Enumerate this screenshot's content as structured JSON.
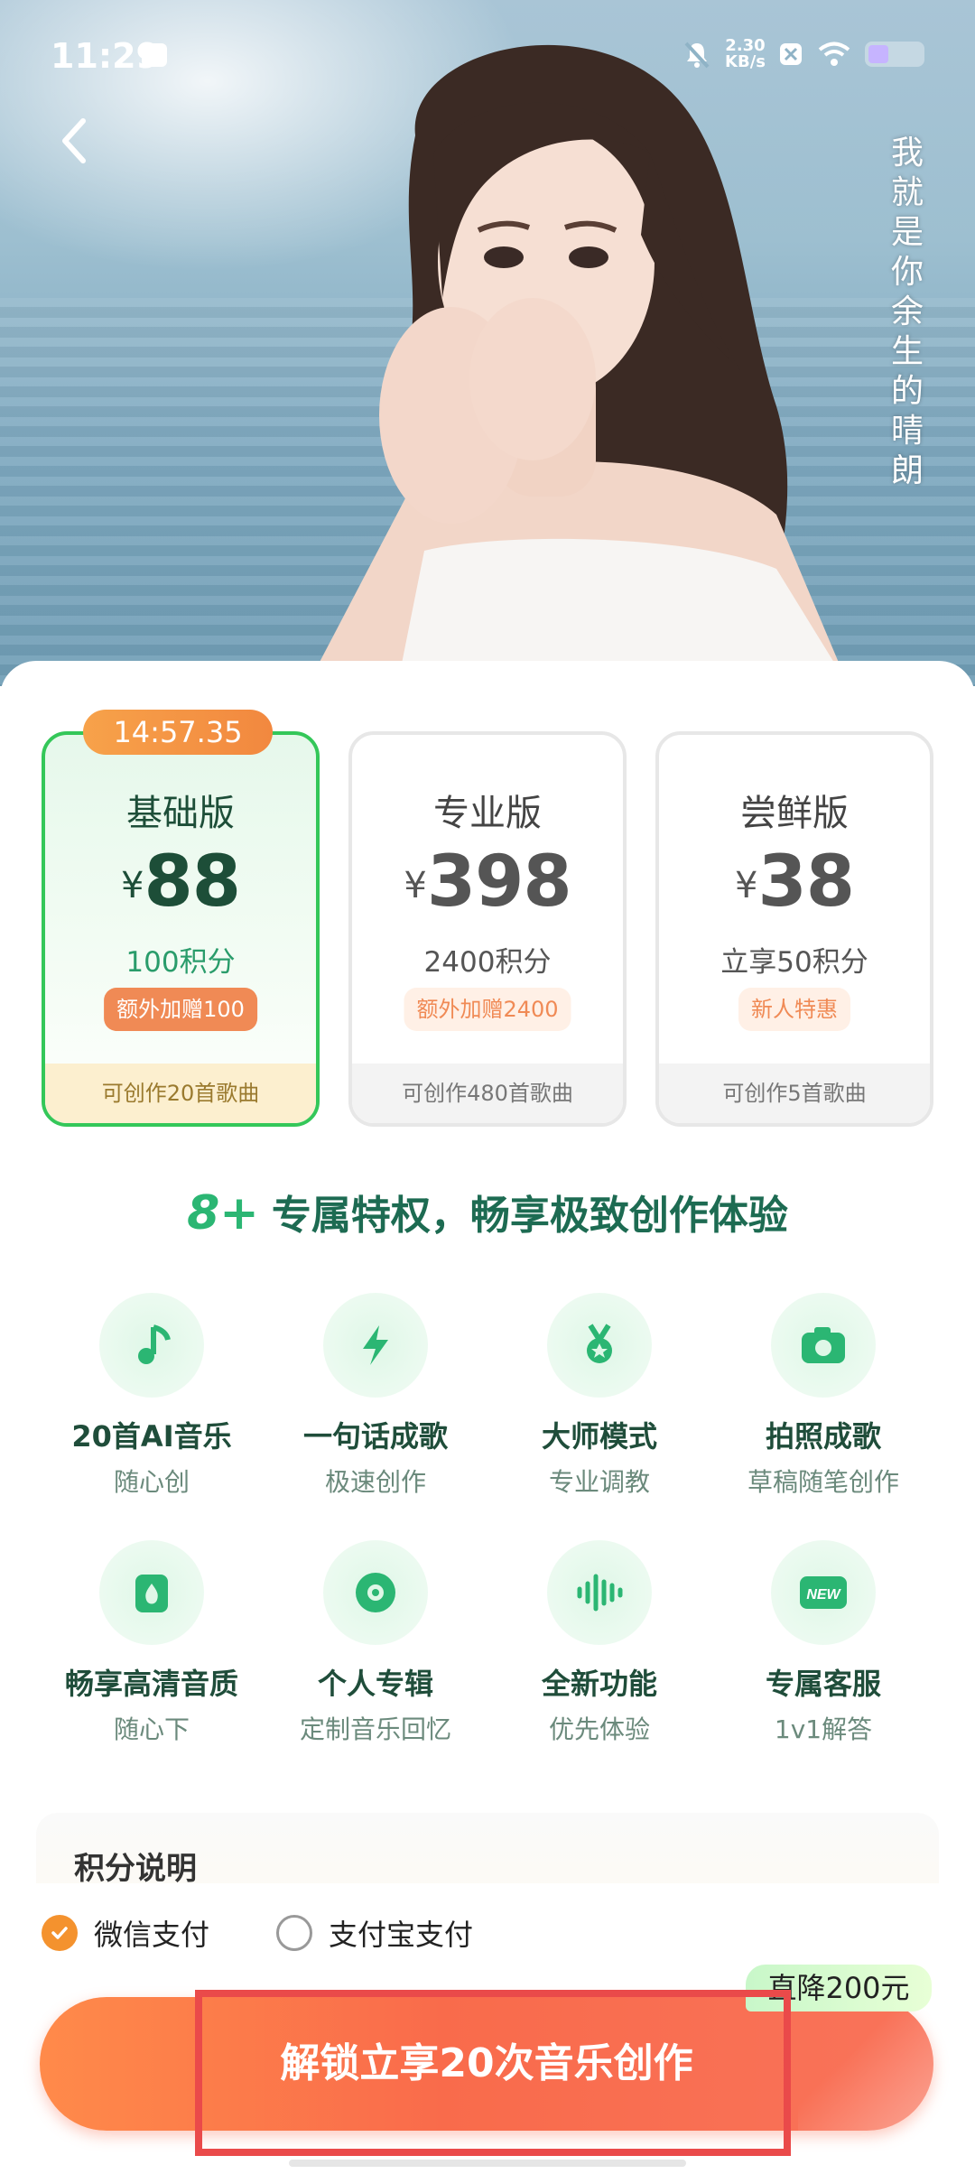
{
  "status_bar": {
    "time": "11:29",
    "net_speed_value": "2.30",
    "net_speed_unit": "KB/s",
    "battery_level": 0.35
  },
  "hero": {
    "vertical_text": "我就是你余生的晴朗"
  },
  "plans": [
    {
      "timer": "14:57.35",
      "name": "基础版",
      "currency": "¥",
      "price": "88",
      "points": "100积分",
      "badge": "额外加赠100",
      "footer": "可创作20首歌曲",
      "selected": true
    },
    {
      "name": "专业版",
      "currency": "¥",
      "price": "398",
      "points": "2400积分",
      "badge": "额外加赠2400",
      "footer": "可创作480首歌曲",
      "selected": false
    },
    {
      "name": "尝鲜版",
      "currency": "¥",
      "price": "38",
      "points": "立享50积分",
      "badge": "新人特惠",
      "footer": "可创作5首歌曲",
      "selected": false
    }
  ],
  "privileges": {
    "count_label": "8+",
    "headline": "专属特权，畅享极致创作体验",
    "items": [
      {
        "title": "20首AI音乐",
        "subtitle": "随心创",
        "icon": "music-note-icon"
      },
      {
        "title": "一句话成歌",
        "subtitle": "极速创作",
        "icon": "lightning-icon"
      },
      {
        "title": "大师模式",
        "subtitle": "专业调教",
        "icon": "medal-icon"
      },
      {
        "title": "拍照成歌",
        "subtitle": "草稿随笔创作",
        "icon": "camera-icon"
      },
      {
        "title": "畅享高清音质",
        "subtitle": "随心下",
        "icon": "audio-file-icon"
      },
      {
        "title": "个人专辑",
        "subtitle": "定制音乐回忆",
        "icon": "disc-icon"
      },
      {
        "title": "全新功能",
        "subtitle": "优先体验",
        "icon": "waveform-icon"
      },
      {
        "title": "专属客服",
        "subtitle": "1v1解答",
        "icon": "new-badge-icon",
        "icon_text": "NEW"
      }
    ]
  },
  "points_info": {
    "title": "积分说明"
  },
  "payment": {
    "options": [
      {
        "label": "微信支付",
        "selected": true
      },
      {
        "label": "支付宝支付",
        "selected": false
      }
    ],
    "discount_tag": "直降200元",
    "cta_label": "解锁立享20次音乐创作"
  },
  "colors": {
    "accent_green": "#34c759",
    "cta_orange": "#f96b4b",
    "highlight_red": "#ea4a4a"
  }
}
